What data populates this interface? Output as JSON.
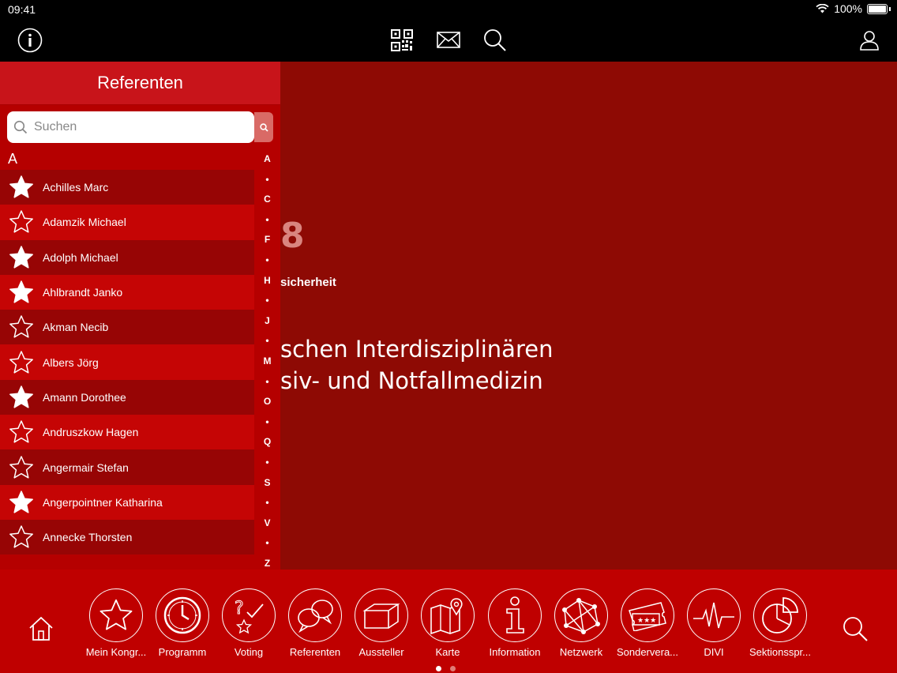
{
  "status": {
    "time": "09:41",
    "battery": "100%"
  },
  "nav": {
    "icons": [
      "info-icon",
      "qr-code-icon",
      "mail-icon",
      "search-icon",
      "user-icon"
    ]
  },
  "background": {
    "big": "8",
    "small": "sicherheit",
    "line1": "schen Interdisziplinären",
    "line2": "siv- und Notfallmedizin"
  },
  "panel": {
    "title": "Referenten",
    "search_placeholder": "Suchen",
    "section": "A",
    "speakers": [
      {
        "name": "Achilles Marc",
        "fav": true
      },
      {
        "name": "Adamzik Michael",
        "fav": false
      },
      {
        "name": "Adolph Michael",
        "fav": true
      },
      {
        "name": "Ahlbrandt Janko",
        "fav": true
      },
      {
        "name": "Akman Necib",
        "fav": false
      },
      {
        "name": "Albers Jörg",
        "fav": false
      },
      {
        "name": "Amann Dorothee",
        "fav": true
      },
      {
        "name": "Andruszkow Hagen",
        "fav": false
      },
      {
        "name": "Angermair Stefan",
        "fav": false
      },
      {
        "name": "Angerpointner Katharina",
        "fav": true
      },
      {
        "name": "Annecke Thorsten",
        "fav": false
      }
    ],
    "index": [
      "A",
      "•",
      "C",
      "•",
      "F",
      "•",
      "H",
      "•",
      "J",
      "•",
      "M",
      "•",
      "O",
      "•",
      "Q",
      "•",
      "S",
      "•",
      "V",
      "•",
      "Z"
    ]
  },
  "dock": {
    "items": [
      {
        "label": "Mein Kongr...",
        "icon": "star-icon"
      },
      {
        "label": "Programm",
        "icon": "clock-icon"
      },
      {
        "label": "Voting",
        "icon": "voting-icon"
      },
      {
        "label": "Referenten",
        "icon": "speech-bubbles-icon"
      },
      {
        "label": "Aussteller",
        "icon": "box-icon"
      },
      {
        "label": "Karte",
        "icon": "map-icon"
      },
      {
        "label": "Information",
        "icon": "info-icon"
      },
      {
        "label": "Netzwerk",
        "icon": "network-icon"
      },
      {
        "label": "Sondervera...",
        "icon": "tickets-icon"
      },
      {
        "label": "DIVI",
        "icon": "heartbeat-icon"
      },
      {
        "label": "Sektionsspr...",
        "icon": "pie-icon"
      }
    ]
  }
}
